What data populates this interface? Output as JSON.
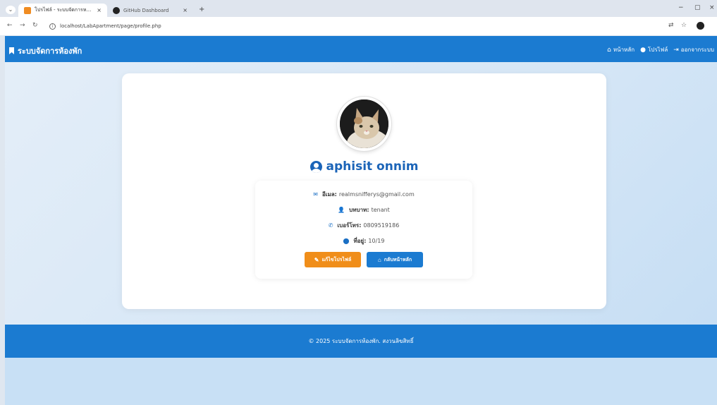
{
  "browser": {
    "tabs": [
      {
        "title": "โปรไฟล์ - ระบบจัดการหอพักนักศึกษา"
      },
      {
        "title": "GitHub Dashboard"
      }
    ],
    "new_tab": "+",
    "url": "localhost/LabApartment/page/profile.php",
    "controls": {
      "minimize": "−",
      "maximize": "▢",
      "close": "×"
    }
  },
  "navbar": {
    "brand": "ระบบจัดการห้องพัก",
    "links": [
      {
        "label": "หน้าหลัก",
        "icon": "home-icon"
      },
      {
        "label": "โปรไฟล์",
        "icon": "user-icon"
      },
      {
        "label": "ออกจากระบบ",
        "icon": "logout-icon"
      }
    ]
  },
  "profile": {
    "name": "aphisit onnim",
    "email_label": "อีเมล:",
    "email": "realmsnifferys@gmail.com",
    "role_label": "บทบาท:",
    "role": "tenant",
    "phone_label": "เบอร์โทร:",
    "phone": "0809519186",
    "address_label": "ที่อยู่:",
    "address": "10/19",
    "edit_button": "แก้ไขโปรไฟล์",
    "home_button": "กลับหน้าหลัก"
  },
  "footer": {
    "text": "© 2025 ระบบจัดการห้องพัก. สงวนลิขสิทธิ์"
  },
  "colors": {
    "navbar": "#1b7bd1",
    "accent_orange": "#f08e1a",
    "name_blue": "#1b64b8"
  }
}
